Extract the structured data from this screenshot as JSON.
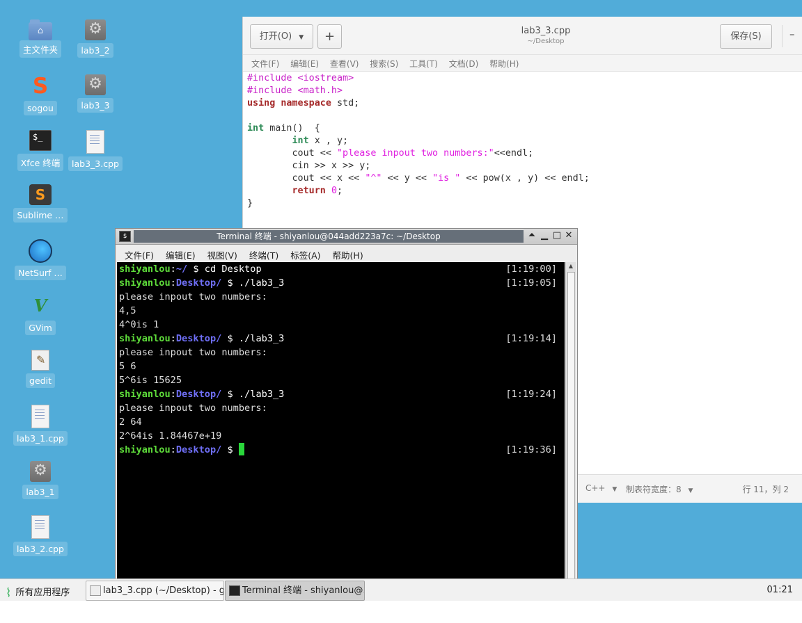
{
  "desktop": {
    "icons": [
      {
        "label": "主文件夹",
        "icon": "home-folder-icon"
      },
      {
        "label": "lab3_2",
        "icon": "executable-icon"
      },
      {
        "label": "sogou",
        "icon": "sogou-icon"
      },
      {
        "label": "lab3_3",
        "icon": "executable-icon"
      },
      {
        "label": "Xfce 终端",
        "icon": "terminal-icon"
      },
      {
        "label": "lab3_3.cpp",
        "icon": "text-file-icon"
      },
      {
        "label": "Sublime …",
        "icon": "sublime-icon"
      },
      {
        "label": "NetSurf …",
        "icon": "netsurf-icon"
      },
      {
        "label": "GVim",
        "icon": "gvim-icon"
      },
      {
        "label": "gedit",
        "icon": "gedit-icon"
      },
      {
        "label": "lab3_1.cpp",
        "icon": "text-file-icon"
      },
      {
        "label": "lab3_1",
        "icon": "executable-icon"
      },
      {
        "label": "lab3_2.cpp",
        "icon": "text-file-icon"
      }
    ]
  },
  "gedit": {
    "open_label": "打开(O)",
    "new_label": "+",
    "title": "lab3_3.cpp",
    "subtitle": "~/Desktop",
    "save_label": "保存(S)",
    "minimize_label": "–",
    "menu": [
      "文件(F)",
      "编辑(E)",
      "查看(V)",
      "搜索(S)",
      "工具(T)",
      "文档(D)",
      "帮助(H)"
    ],
    "code": {
      "l1_pp": "#include <iostream>",
      "l2_pp": "#include <math.h>",
      "l3_kw1": "using",
      "l3_kw2": "namespace",
      "l3_rest": " std;",
      "l5_ty": "int",
      "l5_rest": " main()  {",
      "l6_ty": "int",
      "l6_rest": " x , y;",
      "l7_a": "cout << ",
      "l7_str": "\"please inpout two numbers:\"",
      "l7_b": "<<endl;",
      "l8": "cin >> x >> y;",
      "l9_a": "cout << x << ",
      "l9_s1": "\"^\"",
      "l9_b": " << y << ",
      "l9_s2": "\"is \"",
      "l9_c": " << pow(x , y) << endl;",
      "l10_kw": "return",
      "l10_num": "0",
      "l10_end": ";",
      "l11": "}"
    },
    "status": {
      "language": "C++",
      "tab_width": "制表符宽度：8",
      "position": "行 11，列 2"
    }
  },
  "terminal": {
    "title": "Terminal 终端 - shiyanlou@044add223a7c: ~/Desktop",
    "menu": [
      "文件(F)",
      "编辑(E)",
      "视图(V)",
      "终端(T)",
      "标签(A)",
      "帮助(H)"
    ],
    "lines": {
      "l1_user": "shiyanlou",
      "l1_colon": ":",
      "l1_dir": "~/",
      "l1_cmd": " $ cd Desktop",
      "l1_time": "[1:19:00]",
      "l2_user": "shiyanlou",
      "l2_colon": ":",
      "l2_dir": "Desktop/",
      "l2_cmd": " $ ./lab3_3",
      "l2_time": "[1:19:05]",
      "l3": "please inpout two numbers:",
      "l4": "4,5",
      "l5": "4^0is 1",
      "l6_user": "shiyanlou",
      "l6_colon": ":",
      "l6_dir": "Desktop/",
      "l6_cmd": " $ ./lab3_3",
      "l6_time": "[1:19:14]",
      "l7": "please inpout two numbers:",
      "l8": "5 6",
      "l9": "5^6is 15625",
      "l10_user": "shiyanlou",
      "l10_colon": ":",
      "l10_dir": "Desktop/",
      "l10_cmd": " $ ./lab3_3",
      "l10_time": "[1:19:24]",
      "l11": "please inpout two numbers:",
      "l12": "2 64",
      "l13": "2^64is 1.84467e+19",
      "l14_user": "shiyanlou",
      "l14_colon": ":",
      "l14_dir": "Desktop/",
      "l14_cmd": " $ ",
      "l14_time": "[1:19:36]"
    }
  },
  "taskbar": {
    "apps_label": "所有应用程序",
    "items": [
      {
        "label": "lab3_3.cpp (~/Desktop) - g…",
        "active": false
      },
      {
        "label": "Terminal 终端 - shiyanlou@…",
        "active": true
      }
    ],
    "clock": "01:21"
  }
}
